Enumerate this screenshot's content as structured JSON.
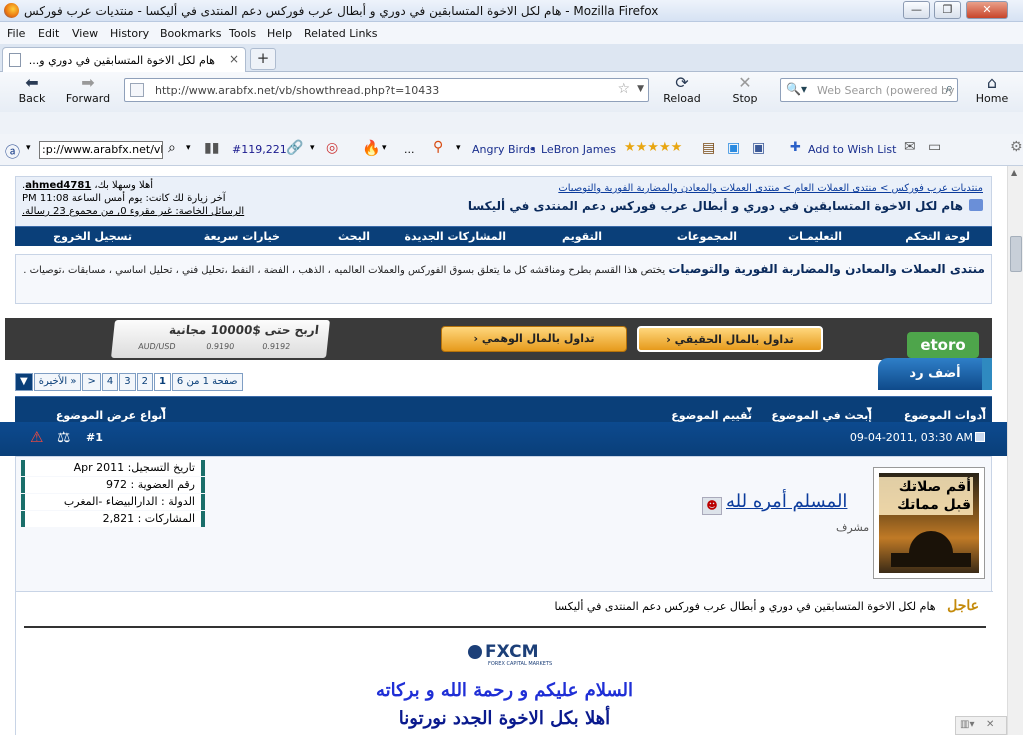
{
  "window": {
    "title": "هام لكل الاخوة المتسابقين في دوري و أبطال عرب فوركس دعم المنتدى في أليكسا - منتديات عرب فوركس - Mozilla Firefox",
    "btn_min": "—",
    "btn_max": "❐",
    "btn_close": "✕"
  },
  "menu": [
    "File",
    "Edit",
    "View",
    "History",
    "Bookmarks",
    "Tools",
    "Help",
    "Related Links"
  ],
  "tab": {
    "label": "هام لكل الاخوة المتسابقين في دوري و...",
    "close": "×",
    "new": "+"
  },
  "nav": {
    "back": "Back",
    "forward": "Forward",
    "reload": "Reload",
    "stop": "Stop",
    "home": "Home",
    "url": "http://www.arabfx.net/vb/showthread.php?t=10433",
    "search_placeholder": "Web Search (powered by"
  },
  "toolbar2": {
    "url": ":p://www.arabfx.net/vb",
    "rank": "#119,221",
    "dots": "...",
    "link1": "Angry Birds",
    "link2": "LeBron James",
    "stars": "★★★★★",
    "wishlist": "Add to Wish List"
  },
  "forum": {
    "breadcrumb": "منتديات عرب فوركس > منتدى العملات العام > منتدى العملات والمعادن والمضاربة الفورية والتوصيات",
    "thread_title": "هام لكل الاخوة المتسابقين في دوري و أبطال عرب فوركس دعم المنتدى في أليكسا",
    "welcome_prefix": "أهلا وسهلا بك",
    "username": "ahmed4781",
    "last_visit": "آخر زيارة لك كانت: يوم أمس الساعة 11:08 PM",
    "private_msgs": "الرسائل الخاصة: غير مقروء 0, من مجموع 23 رسالة.",
    "navitems": [
      "لوحة التحكم",
      "التعليمـات",
      "المجموعات",
      "التقويم",
      "المشاركات الجديدة",
      "البحث",
      "خيارات سريعة",
      "تسجيل الخروج"
    ],
    "forum_name": "منتدى العملات والمعادن والمضاربة الفورية والتوصيات",
    "forum_desc": "يختص هذا القسم بطرح ومناقشه كل ما يتعلق بسوق الفوركس والعملات العالميه ، الذهب ، الفضة ، النفط ،تحليل فني ، تحليل اساسي ، مسابقات ،توصيات .",
    "banner_card": "اربح حتى $10000 مجانية",
    "banner_pair": "AUD/USD",
    "banner_q1": "0.9190",
    "banner_q2": "0.9192",
    "btn_real": "تداول بالمال الحقيقي",
    "btn_demo": "تداول بالمال الوهمي",
    "etoro": "etoro",
    "reply": "أضف رد",
    "pager": [
      "صفحة 1 من 6",
      "1",
      "2",
      "3",
      "4",
      ">",
      "الأخيرة »"
    ],
    "thread_tools": [
      "أدوات الموضوع",
      "إبحث في الموضوع",
      "تقييم الموضوع",
      "انواع عرض الموضوع"
    ],
    "post_date": "09-04-2011, 03:30 AM",
    "post_num": "#1",
    "stats": [
      "تاريخ التسجيل: Apr 2011",
      "رقم العضوية : 972",
      "الدولة : الدارالبيضاء -المغرب",
      "المشاركات : 2,821"
    ],
    "avatar_text": "أقم صلاتك قبل مماتك",
    "poster": "المسلم أمره لله",
    "role": "مشرف",
    "subject_label": "عاجل",
    "subject": "هام لكل الاخوة المتسابقين في دوري و أبطال عرب فوركس دعم المنتدى في أليكسا",
    "fxcm": "FXCM",
    "fxcm_sub": "FOREX CAPITAL MARKETS",
    "greet1": "السلام عليكم و رحمة الله و بركاته",
    "greet2": "أهلا بكل الاخوة الجدد نورتونا"
  },
  "colors": {
    "navy": "#0a3f79",
    "link": "#0b3b9c",
    "greet": "#1f2fd6",
    "label": "#c48a0a"
  }
}
